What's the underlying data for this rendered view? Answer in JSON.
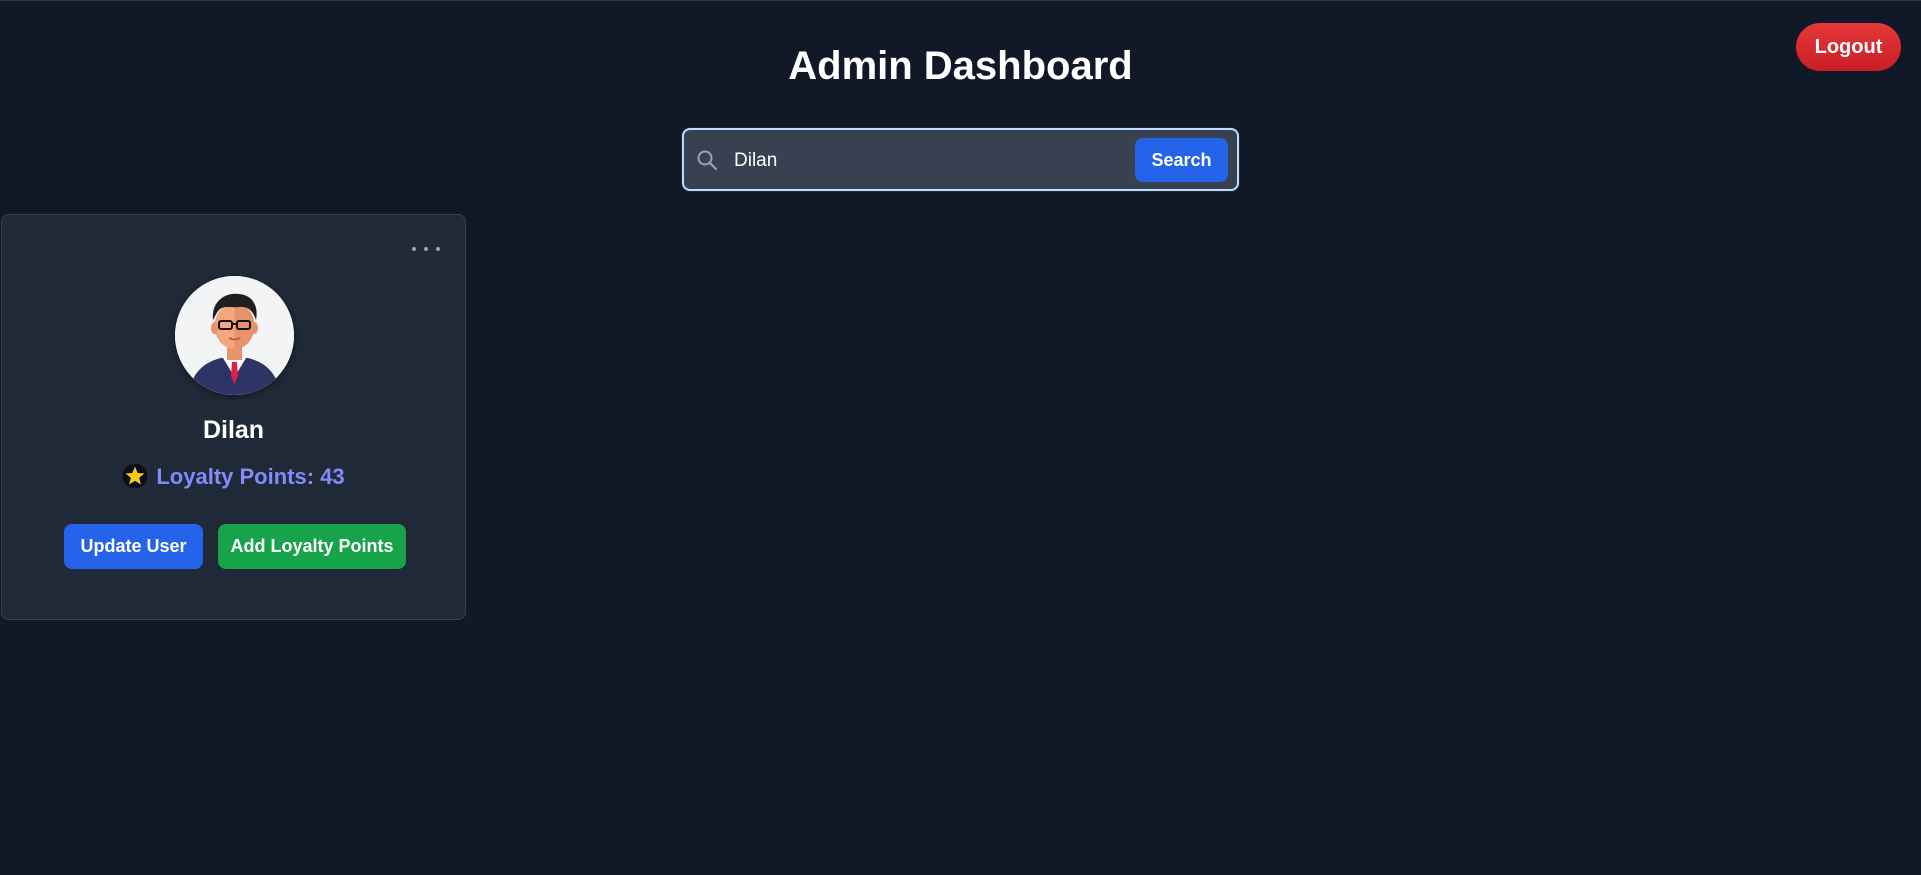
{
  "header": {
    "title": "Admin Dashboard",
    "logout_label": "Logout"
  },
  "search": {
    "value": "Dilan",
    "button_label": "Search",
    "icon": "search-icon"
  },
  "user_card": {
    "name": "Dilan",
    "loyalty_label": "Loyalty Points: 43",
    "loyalty_points": 43,
    "menu_icon": "more-horizontal-icon",
    "avatar_icon": "user-avatar",
    "star_icon": "star-icon",
    "update_label": "Update User",
    "add_points_label": "Add Loyalty Points"
  },
  "colors": {
    "background": "#111827",
    "card": "#1f2937",
    "primary": "#2563eb",
    "success": "#16a34a",
    "danger": "#dc2626",
    "loyalty_text": "#818cf8"
  }
}
